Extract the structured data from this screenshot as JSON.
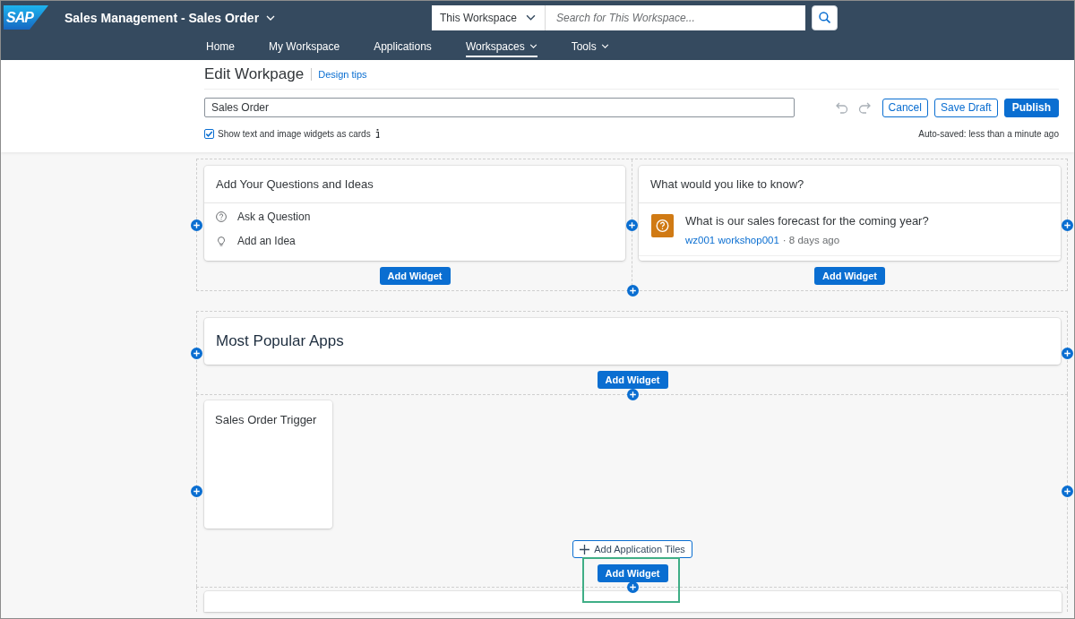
{
  "shell": {
    "logo": "SAP",
    "title": "Sales Management - Sales Order",
    "scope": {
      "value": "This Workspace"
    },
    "search": {
      "placeholder": "Search for This Workspace..."
    }
  },
  "nav": [
    {
      "label": "Home",
      "selected": false,
      "menu": false
    },
    {
      "label": "My Workspace",
      "selected": false,
      "menu": false
    },
    {
      "label": "Applications",
      "selected": false,
      "menu": false
    },
    {
      "label": "Workspaces",
      "selected": true,
      "menu": true
    },
    {
      "label": "Tools",
      "selected": false,
      "menu": true
    }
  ],
  "editor": {
    "title": "Edit Workpage",
    "tips_link": "Design tips",
    "name_field": {
      "value": "Sales Order"
    },
    "actions": [
      {
        "label": "Cancel",
        "kind": "secondary"
      },
      {
        "label": "Save Draft",
        "kind": "secondary"
      },
      {
        "label": "Publish",
        "kind": "primary"
      }
    ],
    "cards_option": {
      "label": "Show text and image widgets as cards",
      "checked": true
    },
    "autosave": "Auto-saved: less than a minute ago"
  },
  "sections": [
    {
      "kind": "columns",
      "columns": [
        {
          "widget": {
            "kind": "ideas",
            "title": "Add Your Questions and Ideas",
            "items": [
              "Ask a Question",
              "Add an Idea"
            ]
          },
          "add_button": "Add Widget"
        },
        {
          "widget": {
            "kind": "feed",
            "title": "What would you like to know?",
            "posts": [
              {
                "text": "What is our sales forecast for the coming year?",
                "author": "wz001 workshop001",
                "meta": "· 8 days ago"
              }
            ]
          },
          "add_button": "Add Widget"
        }
      ]
    },
    {
      "kind": "widget",
      "widget": {
        "kind": "heading",
        "title": "Most Popular Apps"
      },
      "add_button": "Add Widget",
      "highlighted": false
    },
    {
      "kind": "tiles",
      "tiles": [
        {
          "title": "Sales Order Trigger"
        }
      ],
      "tiles_button": "Add Application Tiles",
      "add_button": "Add Widget",
      "highlighted": true
    },
    {
      "kind": "cut"
    }
  ]
}
